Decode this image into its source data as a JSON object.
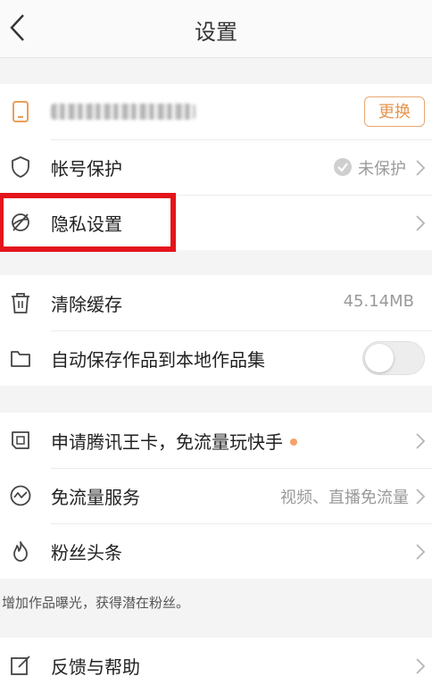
{
  "header": {
    "title": "设置"
  },
  "account": {
    "change_label": "更换",
    "protection_label": "帐号保护",
    "protection_status": "未保护"
  },
  "privacy": {
    "label": "隐私设置"
  },
  "storage": {
    "clear_cache_label": "清除缓存",
    "cache_size": "45.14MB",
    "autosave_label": "自动保存作品到本地作品集",
    "autosave_enabled": false
  },
  "services": {
    "wangka_label": "申请腾讯王卡，免流量玩快手",
    "free_traffic_label": "免流量服务",
    "free_traffic_value": "视频、直播免流量",
    "fans_label": "粉丝头条"
  },
  "hint": "增加作品曝光，获得潜在粉丝。",
  "feedback_label": "反馈与帮助",
  "colors": {
    "accent": "#e4964f",
    "highlight": "#e4141b",
    "dot": "#f4a26a"
  }
}
